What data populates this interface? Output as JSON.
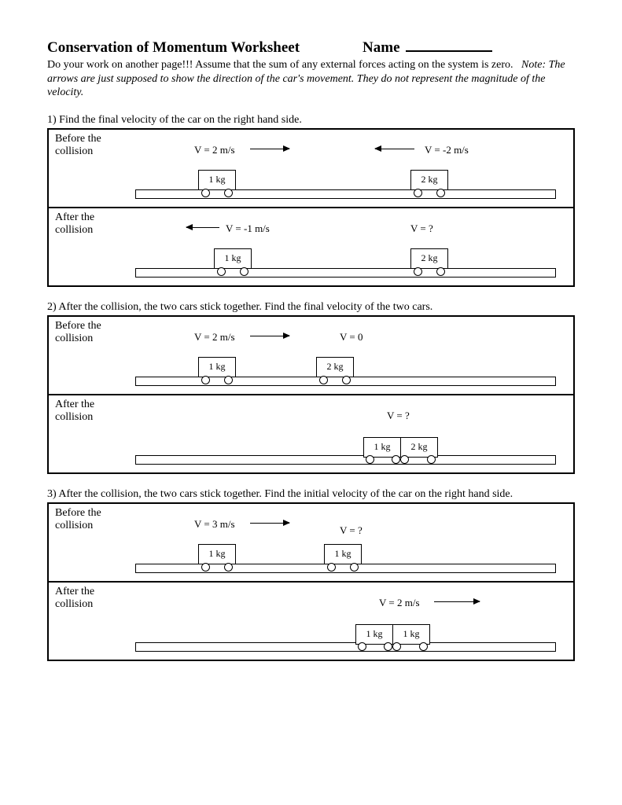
{
  "header": {
    "title": "Conservation of Momentum Worksheet",
    "name_label": "Name"
  },
  "instructions": {
    "line1": "Do your work on another page!!!  Assume that the sum of any external forces acting on the system is zero.",
    "note": "Note:  The arrows are just supposed to show the direction of the car's movement.  They do not represent the magnitude of the velocity."
  },
  "labels": {
    "before": "Before the collision",
    "after": "After the collision"
  },
  "problems": [
    {
      "question": "1)  Find the final velocity of the car on the right hand side.",
      "before": {
        "car1": {
          "mass": "1 kg",
          "v": "V = 2 m/s"
        },
        "car2": {
          "mass": "2 kg",
          "v": "V = -2 m/s"
        }
      },
      "after": {
        "car1": {
          "mass": "1 kg",
          "v": "V = -1 m/s"
        },
        "car2": {
          "mass": "2 kg",
          "v": "V = ?"
        }
      }
    },
    {
      "question": "2)  After the collision, the two cars stick together.  Find the final velocity of the two cars.",
      "before": {
        "car1": {
          "mass": "1 kg",
          "v": "V = 2 m/s"
        },
        "car2": {
          "mass": "2 kg",
          "v": "V = 0"
        }
      },
      "after": {
        "joined": {
          "mass1": "1 kg",
          "mass2": "2 kg",
          "v": "V = ?"
        }
      }
    },
    {
      "question": "3)  After the collision, the two cars stick together.  Find the initial velocity of the car on the right hand side.",
      "before": {
        "car1": {
          "mass": "1 kg",
          "v": "V = 3 m/s"
        },
        "car2": {
          "mass": "1 kg",
          "v": "V = ?"
        }
      },
      "after": {
        "joined": {
          "mass1": "1 kg",
          "mass2": "1 kg",
          "v": "V = 2 m/s"
        }
      }
    }
  ]
}
